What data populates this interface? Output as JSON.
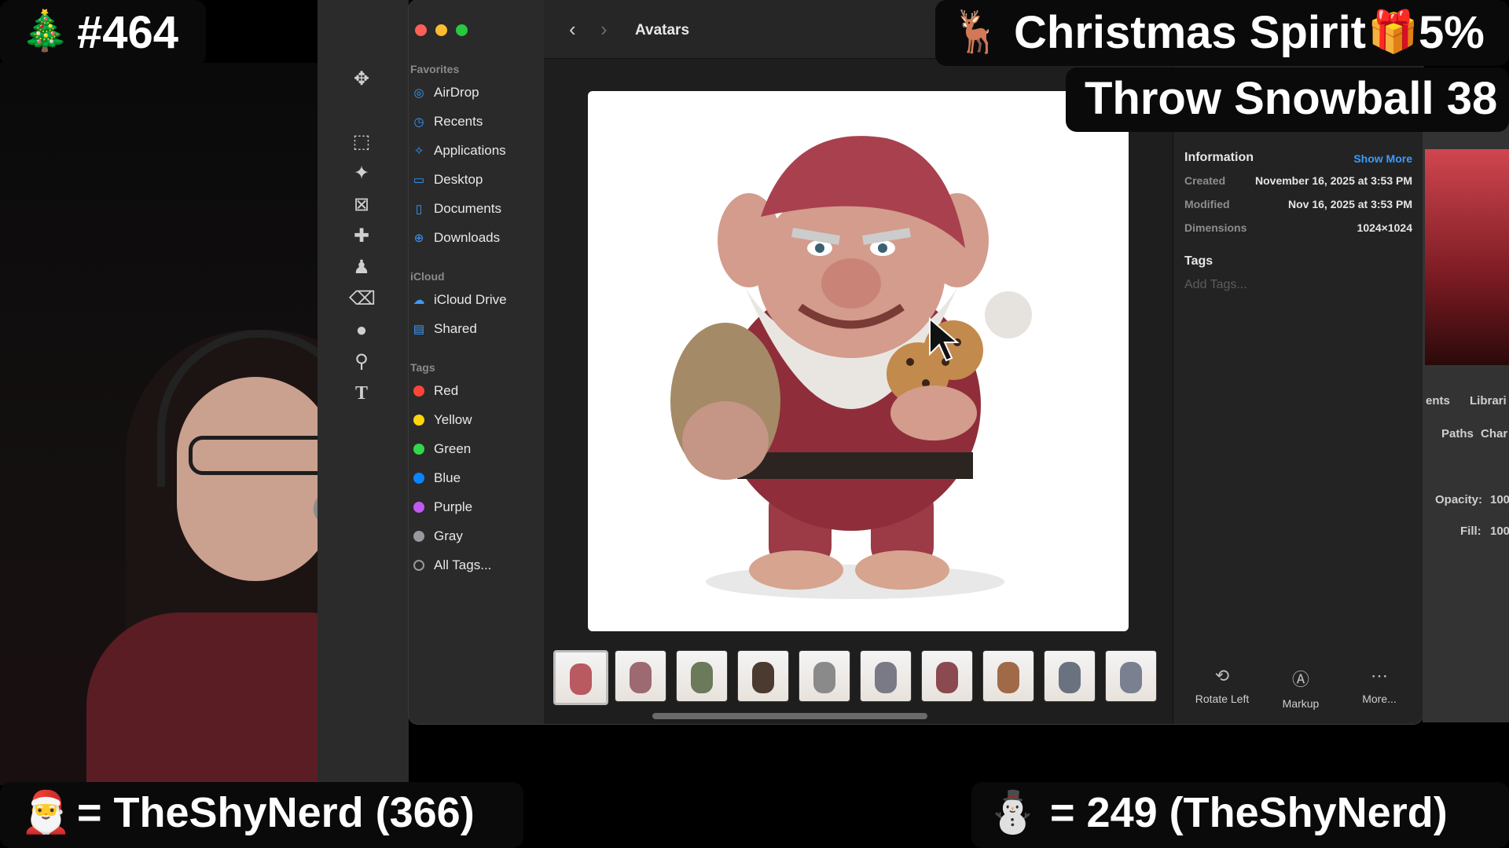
{
  "stream_overlay": {
    "counter": "#464",
    "christmas_spirit": "Christmas Spirit",
    "christmas_spirit_value": "5%",
    "throw_snowball": "Throw Snowball 38",
    "santa_leader": "= TheShyNerd (366)",
    "snowman_leader": "=  249 (TheShyNerd)",
    "icons": [
      "christmas-tree-icon",
      "reindeer-icon",
      "gift-icon",
      "santa-icon",
      "snowman-icon"
    ]
  },
  "finder": {
    "title": "Avatars",
    "sidebar": {
      "favorites_heading": "Favorites",
      "favorites": [
        {
          "label": "AirDrop",
          "icon": "airdrop-icon"
        },
        {
          "label": "Recents",
          "icon": "clock-icon"
        },
        {
          "label": "Applications",
          "icon": "applications-icon"
        },
        {
          "label": "Desktop",
          "icon": "desktop-icon"
        },
        {
          "label": "Documents",
          "icon": "document-icon"
        },
        {
          "label": "Downloads",
          "icon": "download-icon"
        }
      ],
      "icloud_heading": "iCloud",
      "icloud": [
        {
          "label": "iCloud Drive",
          "icon": "cloud-icon"
        },
        {
          "label": "Shared",
          "icon": "shared-folder-icon"
        }
      ],
      "tags_heading": "Tags",
      "tags": [
        {
          "label": "Red",
          "color": "#ff453a"
        },
        {
          "label": "Yellow",
          "color": "#ffd60a"
        },
        {
          "label": "Green",
          "color": "#32d74b"
        },
        {
          "label": "Blue",
          "color": "#0a84ff"
        },
        {
          "label": "Purple",
          "color": "#bf5af2"
        },
        {
          "label": "Gray",
          "color": "#98989d"
        },
        {
          "label": "All Tags...",
          "color": "outline"
        }
      ]
    },
    "info": {
      "heading": "Information",
      "show_more": "Show More",
      "rows": [
        {
          "key": "Created",
          "value": "November 16, 2025 at 3:53 PM"
        },
        {
          "key": "Modified",
          "value": "Nov 16, 2025 at 3:53 PM"
        },
        {
          "key": "Dimensions",
          "value": "1024×1024"
        }
      ],
      "tags_heading": "Tags",
      "add_tags_placeholder": "Add Tags..."
    },
    "actions": [
      {
        "label": "Rotate Left",
        "icon": "rotate-left-icon"
      },
      {
        "label": "Markup",
        "icon": "markup-icon"
      },
      {
        "label": "More...",
        "icon": "more-icon"
      }
    ],
    "thumbnail_count": 10
  },
  "photoshop": {
    "tabs": [
      "ents",
      "Librari"
    ],
    "tabs2": [
      "Paths",
      "Char"
    ],
    "opacity_label": "Opacity:",
    "opacity_value": "100",
    "fill_label": "Fill:",
    "fill_value": "100"
  }
}
